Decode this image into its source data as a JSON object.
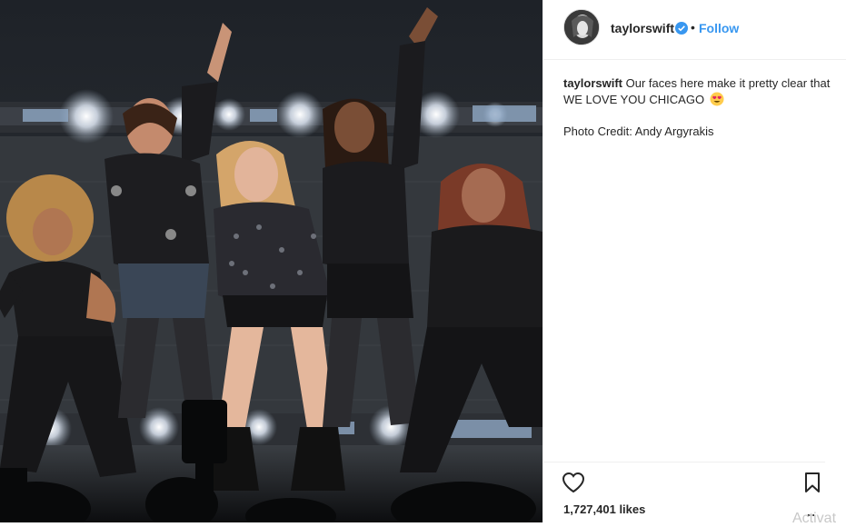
{
  "post": {
    "username": "taylorswift",
    "separator": "•",
    "follow_label": "Follow",
    "caption_username": "taylorswift",
    "caption_text": "Our faces here make it pretty clear that WE LOVE YOU CHICAGO",
    "caption_emoji": "heart-eyes-emoji",
    "credit": "Photo Credit: Andy Argyrakis",
    "likes": "1,727,401 likes",
    "more_label": "..."
  },
  "photo": {
    "subject": "concert-stage-photo"
  },
  "overlay": {
    "watermark": "Activat"
  },
  "colors": {
    "link": "#3897f0",
    "text": "#262626",
    "verified": "#3897f0",
    "divider": "#efefef"
  },
  "icons": {
    "like": "heart-outline-icon",
    "save": "bookmark-icon",
    "verified": "verified-badge-icon"
  }
}
